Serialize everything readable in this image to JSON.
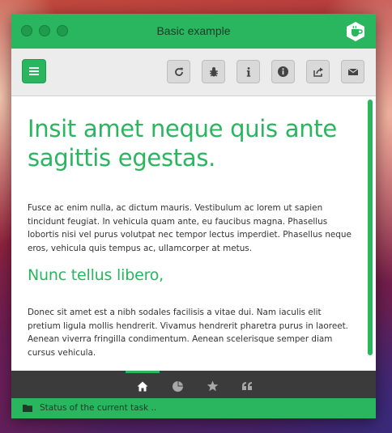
{
  "window": {
    "title": "Basic example",
    "accent": "#2ab55f"
  },
  "toolbar": {
    "menu_icon": "hamburger-icon",
    "buttons": [
      {
        "name": "refresh",
        "icon": "refresh-icon"
      },
      {
        "name": "debug",
        "icon": "bug-icon"
      },
      {
        "name": "info",
        "icon": "info-letter-icon"
      },
      {
        "name": "about",
        "icon": "info-circle-icon"
      },
      {
        "name": "share",
        "icon": "share-icon"
      },
      {
        "name": "mail",
        "icon": "envelope-icon"
      }
    ]
  },
  "content": {
    "heading": "Insit amet neque quis ante sagittis egestas.",
    "paragraph1": "Fusce ac enim nulla, ac dictum mauris. Vestibulum ac lorem ut sapien tincidunt feugiat. In vehicula quam ante, eu faucibus magna. Phasellus lobortis nisi vel purus volutpat nec tempor lectus imperdiet. Phasellus neque eros, vehicula quis tempus ac, ullamcorper at metus.",
    "subheading": "Nunc tellus libero,",
    "paragraph2": "Donec sit amet est a nibh sodales facilisis a vitae dui. Nam iaculis elit pretium ligula mollis hendrerit. Vivamus hendrerit pharetra purus in laoreet. Aenean viverra fringilla condimentum. Aenean scelerisque semper diam cursus vehicula."
  },
  "bottom_nav": {
    "items": [
      {
        "icon": "home-icon",
        "active": true
      },
      {
        "icon": "pie-chart-icon",
        "active": false
      },
      {
        "icon": "star-icon",
        "active": false
      },
      {
        "icon": "quote-icon",
        "active": false
      }
    ]
  },
  "status": {
    "icon": "folder-icon",
    "text": "Status of the current task .."
  }
}
